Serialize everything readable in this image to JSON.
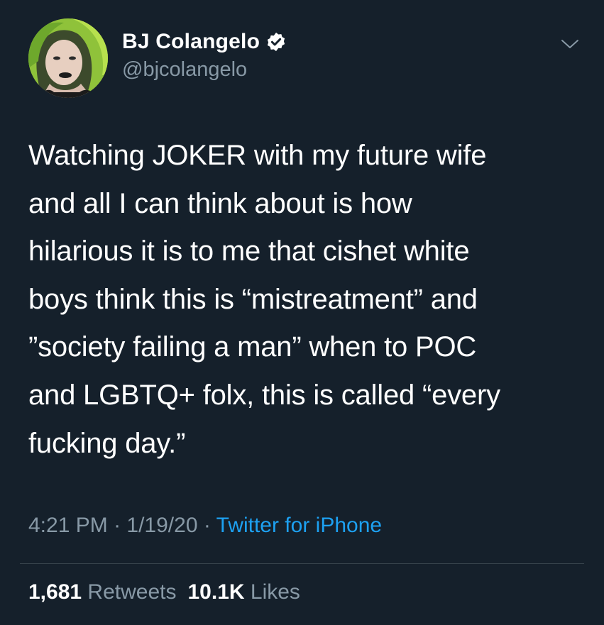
{
  "tweet": {
    "author": {
      "display_name": "BJ Colangelo",
      "handle": "@bjcolangelo",
      "verified": true
    },
    "text_lines": [
      "Watching JOKER with my future wife",
      "and all I can think about is how",
      "hilarious it is to me that cishet white",
      "boys think this is “mistreatment” and",
      "”society failing a man” when to POC",
      "and LGBTQ+ folx, this is called “every",
      "fucking day.”"
    ],
    "meta": {
      "time": "4:21 PM",
      "separator": " · ",
      "date": "1/19/20",
      "source": "Twitter for iPhone"
    },
    "stats": {
      "retweets_count": "1,681",
      "retweets_label": "Retweets",
      "likes_count": "10.1K",
      "likes_label": "Likes"
    }
  },
  "icons": {
    "verified": "verified-badge-icon",
    "menu": "chevron-down-icon"
  },
  "colors": {
    "background": "#15202b",
    "text_primary": "#ffffff",
    "text_secondary": "#8899a6",
    "link": "#1da1f2",
    "divider": "#38444d"
  }
}
